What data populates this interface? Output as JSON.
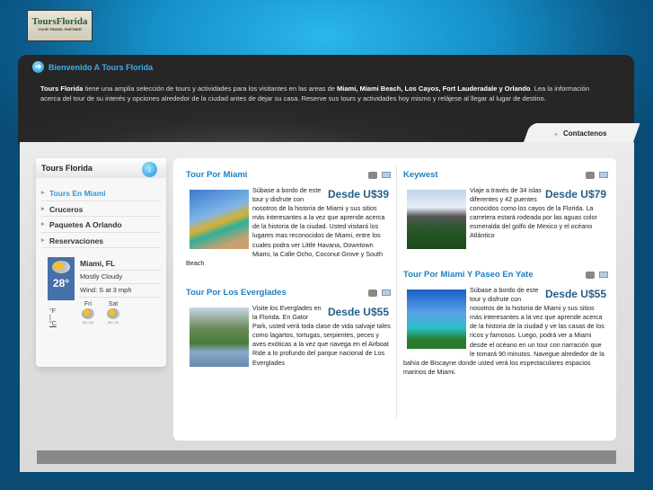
{
  "logo": {
    "title": "ToursFlorida",
    "tagline": "YOUR TRAVEL PARTNER"
  },
  "welcome": {
    "title": "Bienvenido A Tours Florida",
    "intro_brand": "Tours Florida",
    "intro_1": " tiene una amplia selección de tours y actividades para los visitantes en las areas de ",
    "intro_places": "Miami, Miami Beach, Los Cayos, Fort Lauderadale y Orlando",
    "intro_2": ". Lea la información acerca del tour de su interés y opciones alrededor de la ciudad antes de dejar su casa. Reserve sus tours y actividades hoy mismo y relájese al llegar al lugar de destino."
  },
  "nav": {
    "contact": "Contactenos"
  },
  "sidebar": {
    "title": "Tours Florida",
    "items": [
      {
        "label": "Tours En Miami"
      },
      {
        "label": "Cruceros"
      },
      {
        "label": "Paquetes A Orlando"
      },
      {
        "label": "Reservaciones"
      }
    ]
  },
  "weather": {
    "temp": "28°",
    "city": "Miami, FL",
    "condition": "Mostly Cloudy",
    "wind": "Wind: S at 3 mph",
    "unit_f": "°F",
    "sep": "|",
    "unit_c": "°C",
    "forecast": [
      {
        "day": "Fri",
        "range": "25 | 31"
      },
      {
        "day": "Sat",
        "range": "26 | 31"
      }
    ]
  },
  "tours": [
    {
      "title": "Tour Por Miami",
      "price": "Desde U$39",
      "text": "Súbase a bordo de este tour y disfrute con nosotros de la historia de Miami y sus sitios más interesantes a la vez que aprende acerca de la historia de la ciudad. Usted visitará los lugares mas reconocidos de Miami, entre los cuales podra ver Little Havana, Downtown Miami, la Calle Ocho, Coconut Grove y South Beach"
    },
    {
      "title": "Tour Por Los Everglades",
      "price": "Desde U$55",
      "text": "Visite los Everglades en la Florida. En Gator Park, usted verá toda clase de vida salvaje tales como lagartos, tortugas, serpientes, peces y aves exóticas a la vez que navega en el Airboat Ride a lo profundo del parque nacional de Los Everglades"
    },
    {
      "title": "Keywest",
      "price": "Desde U$79",
      "text": "Viaje a través de 34 islas diferentes y 42 puentes conocidos como los cayos de la Florida. La carretera estará rodeada por las aguas color esmeralda del golfo de Mexico y el océano Atlántico"
    },
    {
      "title": "Tour Por Miami Y Paseo En Yate",
      "price": "Desde U$55",
      "text": "Súbase a bordo de este tour y disfrute con nosotros de la historia de Miami y sus sitios más interesantes a la vez que aprende acerca de la historia de la ciudad y ve las casas de los ricos y famosos. Luego, podrá ver a Miami desde el océano en un tour con narración que le tomará 90 minutos. Navegue alrededor de la bahía de Biscayne donde usted verá los espectaculares espacios marinos de Miami."
    }
  ]
}
